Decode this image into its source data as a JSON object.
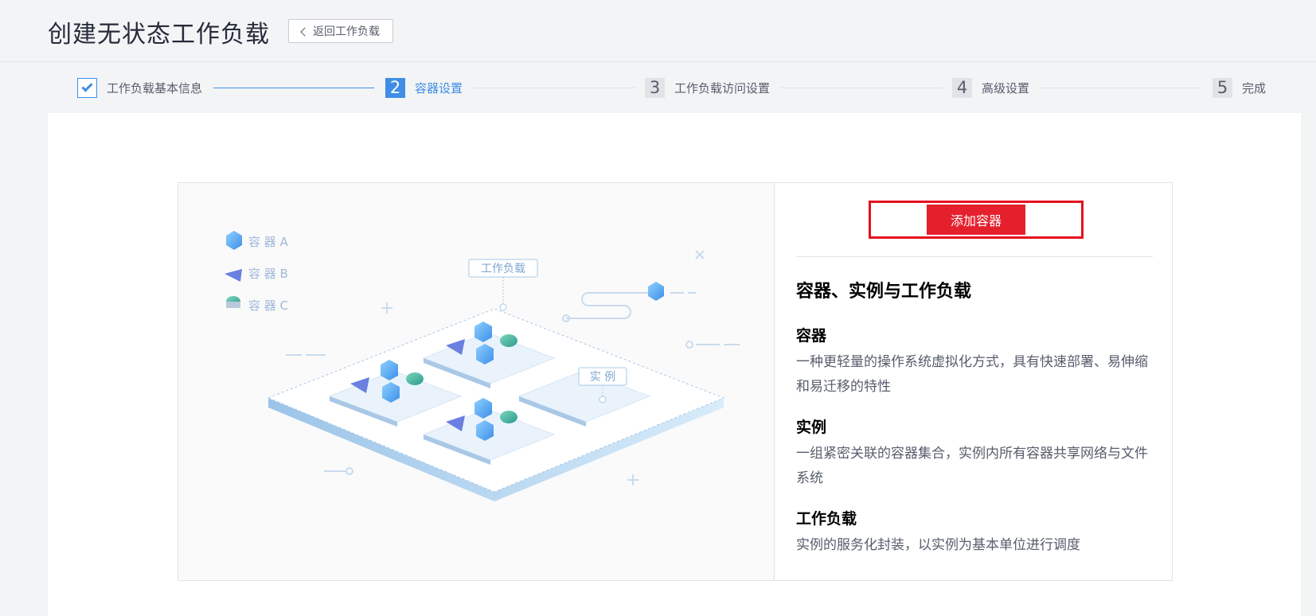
{
  "header": {
    "title": "创建无状态工作负载",
    "back_label": "返回工作负载"
  },
  "steps": [
    {
      "num": "",
      "label": "工作负载基本信息",
      "state": "done"
    },
    {
      "num": "2",
      "label": "容器设置",
      "state": "active"
    },
    {
      "num": "3",
      "label": "工作负载访问设置",
      "state": "todo"
    },
    {
      "num": "4",
      "label": "高级设置",
      "state": "todo"
    },
    {
      "num": "5",
      "label": "完成",
      "state": "todo"
    }
  ],
  "illustration": {
    "legend": [
      "容 器 A",
      "容 器 B",
      "容 器 C"
    ],
    "workload_tag": "工作负载",
    "instance_tag": "实 例"
  },
  "panel": {
    "add_button": "添加容器",
    "title": "容器、实例与工作负载",
    "sections": [
      {
        "heading": "容器",
        "text": "一种更轻量的操作系统虚拟化方式，具有快速部署、易伸缩和易迁移的特性"
      },
      {
        "heading": "实例",
        "text": "一组紧密关联的容器集合，实例内所有容器共享网络与文件系统"
      },
      {
        "heading": "工作负载",
        "text": "实例的服务化封装，以实例为基本单位进行调度"
      }
    ]
  },
  "colors": {
    "accent": "#3f8de6",
    "danger": "#e5202d"
  }
}
